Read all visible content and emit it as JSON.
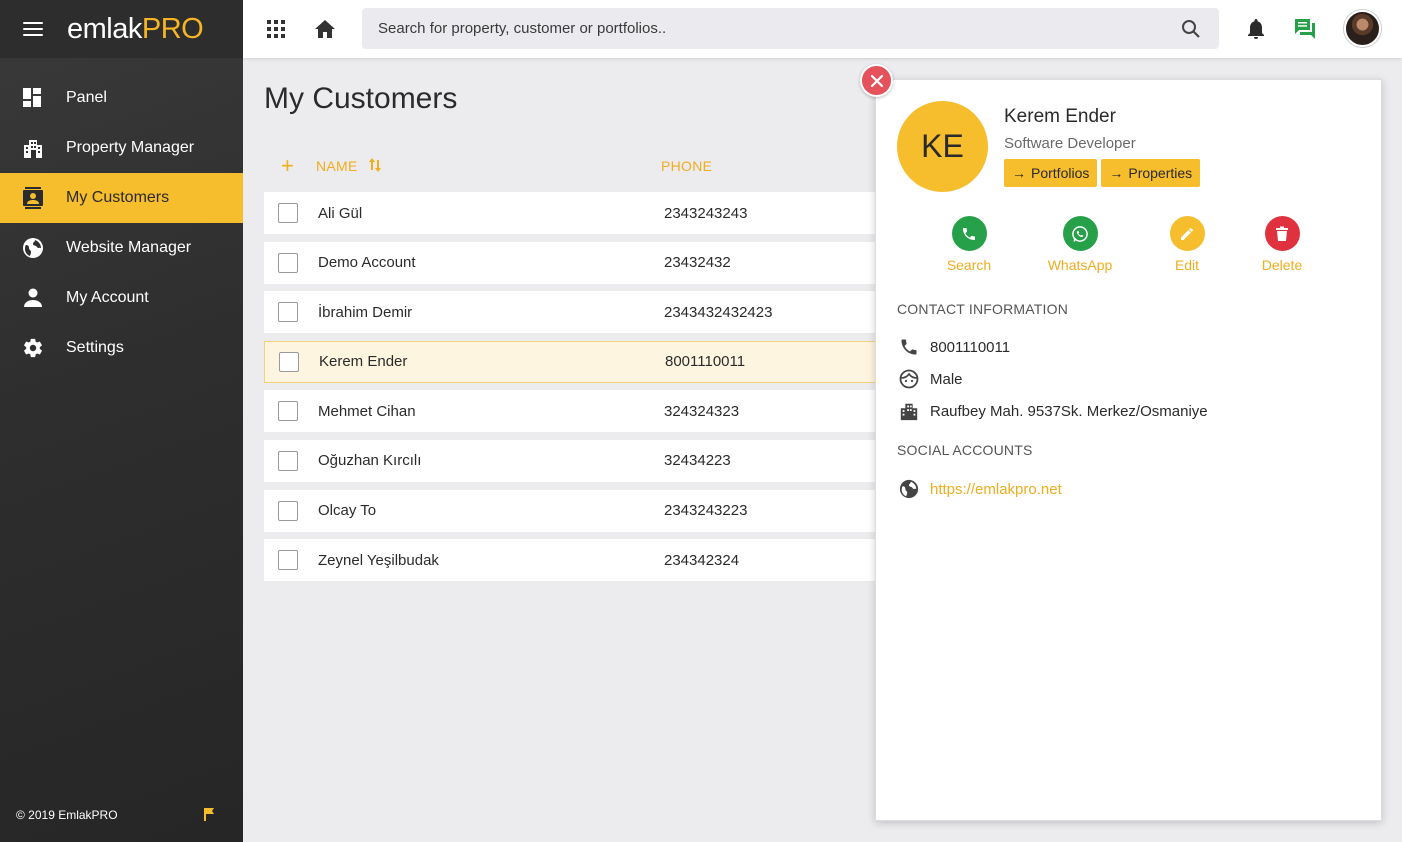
{
  "app": {
    "logo_main": "emlak",
    "logo_accent": "PRO"
  },
  "colors": {
    "accent": "#f6bd2c",
    "accent_text": "#f0ad1e",
    "sidebar_bg": "#2e2e2e",
    "call": "#27a149",
    "whatsapp": "#27a149",
    "edit": "#f6bd2c",
    "delete": "#e0313f",
    "close": "#e6525b"
  },
  "sidebar": {
    "items": [
      {
        "label": "Panel",
        "icon": "dashboard-icon"
      },
      {
        "label": "Property Manager",
        "icon": "building-icon"
      },
      {
        "label": "My Customers",
        "icon": "contacts-icon",
        "active": true
      },
      {
        "label": "Website Manager",
        "icon": "globe-icon"
      },
      {
        "label": "My Account",
        "icon": "person-icon"
      },
      {
        "label": "Settings",
        "icon": "gear-icon"
      }
    ],
    "footer": "© 2019 EmlakPRO",
    "footer_icon": "flag-icon"
  },
  "topbar": {
    "search_placeholder": "Search for property, customer or portfolios..",
    "icons": [
      "apps-grid-icon",
      "home-icon",
      "search-icon",
      "bell-icon",
      "chat-icon",
      "avatar"
    ]
  },
  "main": {
    "title": "My Customers",
    "columns": {
      "add": "+",
      "name": "NAME",
      "phone": "PHONE"
    },
    "rows": [
      {
        "name": "Ali Gül",
        "phone": "2343243243"
      },
      {
        "name": "Demo Account",
        "phone": "23432432"
      },
      {
        "name": "İbrahim Demir",
        "phone": "2343432432423"
      },
      {
        "name": "Kerem Ender",
        "phone": "8001110011",
        "selected": true
      },
      {
        "name": "Mehmet Cihan",
        "phone": "324324323"
      },
      {
        "name": "Oğuzhan Kırcılı",
        "phone": "32434223"
      },
      {
        "name": "Olcay To",
        "phone": "2343243223"
      },
      {
        "name": "Zeynel Yeşilbudak",
        "phone": "234342324"
      }
    ]
  },
  "detail": {
    "initials": "KE",
    "name": "Kerem Ender",
    "role": "Software Developer",
    "buttons": {
      "portfolios": "Portfolios",
      "properties": "Properties"
    },
    "actions": {
      "call": "Search",
      "whatsapp": "WhatsApp",
      "edit": "Edit",
      "delete": "Delete"
    },
    "contact_heading": "CONTACT INFORMATION",
    "phone": "8001110011",
    "gender": "Male",
    "address": "Raufbey Mah. 9537Sk. Merkez/Osmaniye",
    "social_heading": "SOCIAL ACCOUNTS",
    "website": "https://emlakpro.net"
  }
}
